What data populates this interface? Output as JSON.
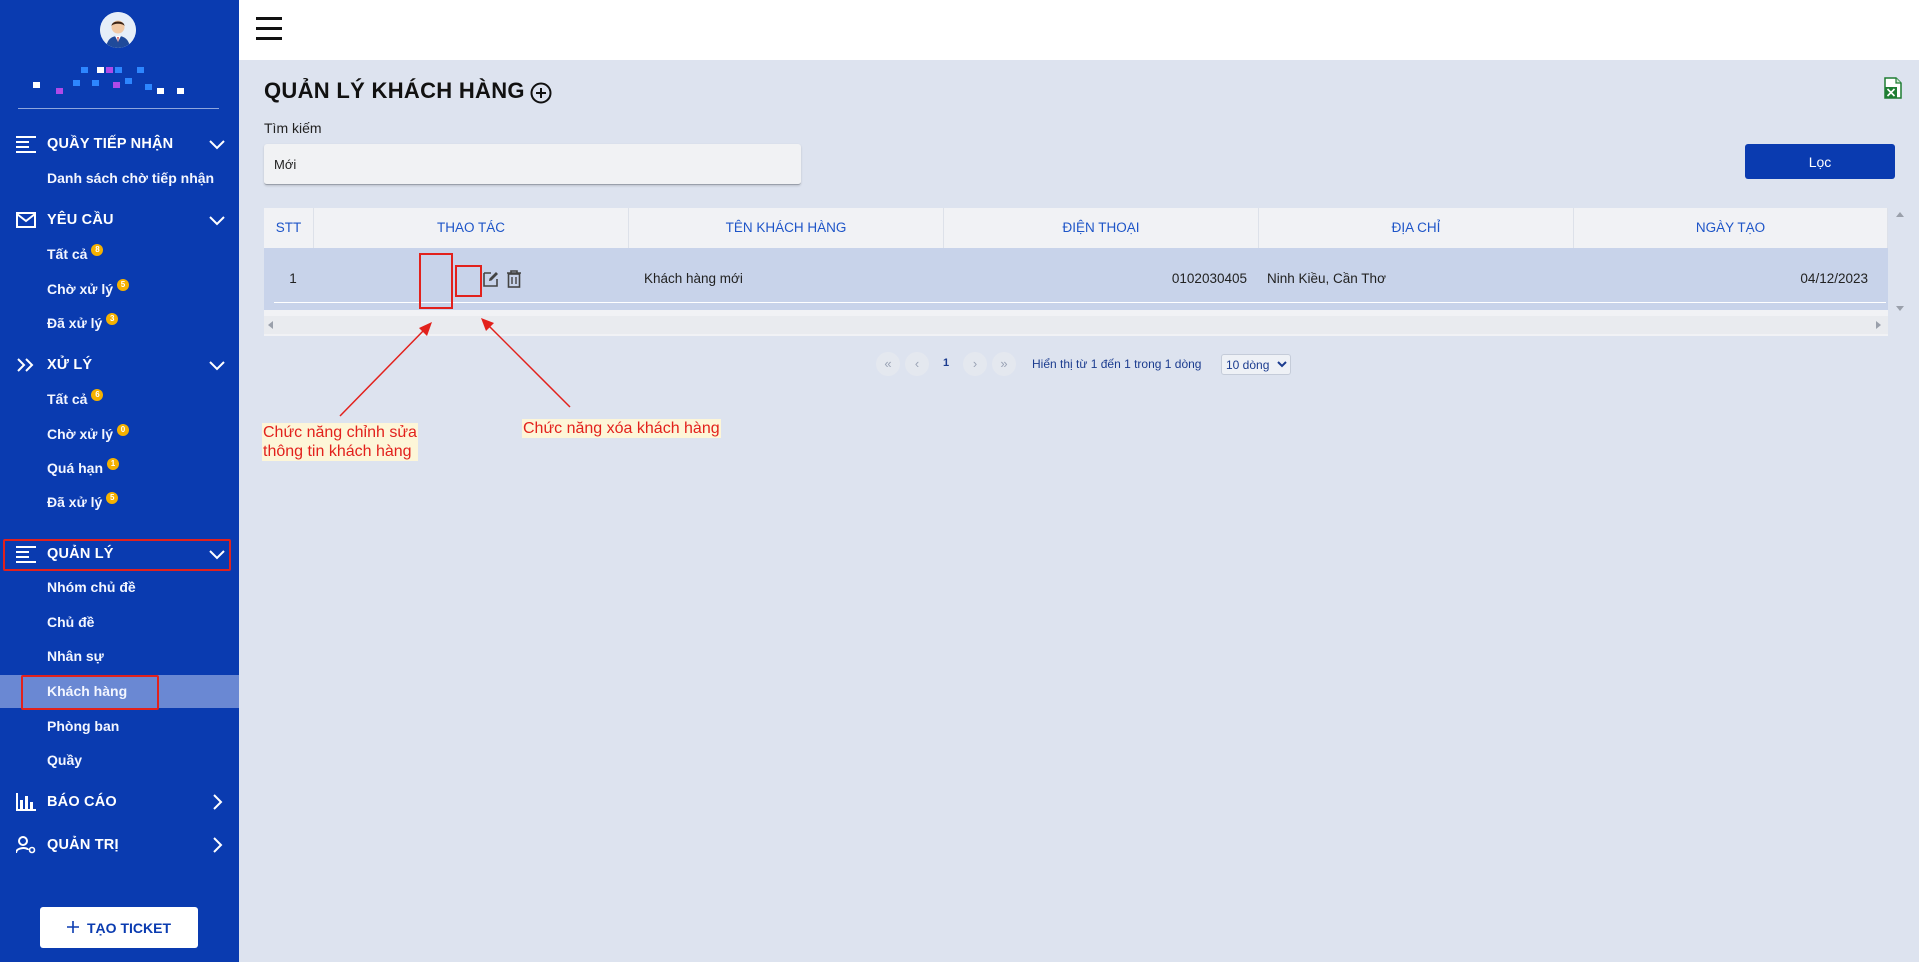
{
  "sidebar": {
    "sections": [
      {
        "title": "QUẦY TIẾP NHẬN",
        "items": [
          {
            "label": "Danh sách chờ tiếp nhận",
            "badge": ""
          }
        ]
      },
      {
        "title": "YÊU CẦU",
        "items": [
          {
            "label": "Tất cả",
            "badge": "8"
          },
          {
            "label": "Chờ xử lý",
            "badge": "5"
          },
          {
            "label": "Đã xử lý",
            "badge": "3"
          }
        ]
      },
      {
        "title": "XỬ LÝ",
        "items": [
          {
            "label": "Tất cả",
            "badge": "6"
          },
          {
            "label": "Chờ xử lý",
            "badge": "0"
          },
          {
            "label": "Quá hạn",
            "badge": "1"
          },
          {
            "label": "Đã xử lý",
            "badge": "5"
          }
        ]
      },
      {
        "title": "QUẢN LÝ",
        "items": [
          {
            "label": "Nhóm chủ đề"
          },
          {
            "label": "Chủ đề"
          },
          {
            "label": "Nhân sự"
          },
          {
            "label": "Khách hàng"
          },
          {
            "label": "Phòng ban"
          },
          {
            "label": "Quầy"
          }
        ]
      },
      {
        "title": "BÁO CÁO"
      },
      {
        "title": "QUẢN TRỊ"
      }
    ],
    "active_item": "Khách hàng",
    "ticket_button": "TẠO TICKET"
  },
  "main": {
    "title": "QUẢN LÝ KHÁCH HÀNG",
    "search_label": "Tìm kiếm",
    "search_value": "Mới",
    "filter_button": "Lọc"
  },
  "table": {
    "columns": [
      "STT",
      "THAO TÁC",
      "TÊN KHÁCH HÀNG",
      "ĐIỆN THOẠI",
      "ĐỊA CHỈ",
      "NGÀY TẠO"
    ],
    "rows": [
      {
        "stt": "1",
        "name": "Khách hàng mới",
        "phone": "0102030405",
        "address": "Ninh Kiều, Cần Thơ",
        "created": "04/12/2023"
      }
    ]
  },
  "pagination": {
    "first": "«",
    "prev": "‹",
    "current": "1",
    "next": "›",
    "last": "»",
    "info": "Hiển thị từ 1 đến 1 trong 1 dòng",
    "page_size": "10 dòng"
  },
  "annotations": {
    "edit_line1": "Chức năng chỉnh sửa",
    "edit_line2": "thông tin khách hàng",
    "delete": "Chức năng xóa khách hàng"
  },
  "colors": {
    "sidebar": "#0a3bb0",
    "highlight": "#e2211c",
    "header_text": "#1e55c8",
    "excel": "#1e7d32"
  }
}
